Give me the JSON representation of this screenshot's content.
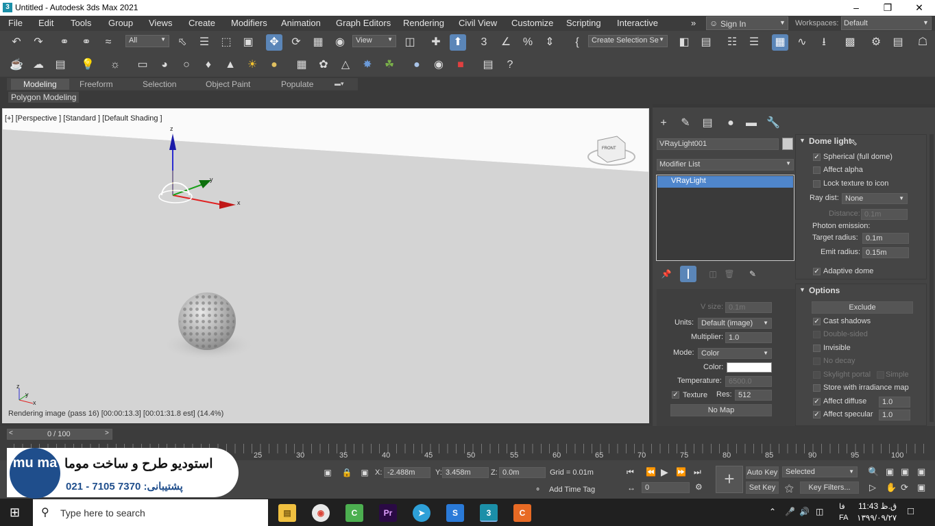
{
  "window": {
    "title": "Untitled - Autodesk 3ds Max 2021",
    "app_icon": "3"
  },
  "menu": [
    "File",
    "Edit",
    "Tools",
    "Group",
    "Views",
    "Create",
    "Modifiers",
    "Animation",
    "Graph Editors",
    "Rendering",
    "Civil View",
    "Customize",
    "Scripting",
    "Interactive"
  ],
  "signin": "Sign In",
  "workspaces": {
    "label": "Workspaces:",
    "value": "Default"
  },
  "toolbar": {
    "selection_filter": "All",
    "ref_coord": "View",
    "named_selection": "Create Selection Se"
  },
  "ribbon": {
    "tabs": [
      "Modeling",
      "Freeform",
      "Selection",
      "Object Paint",
      "Populate"
    ],
    "sub": "Polygon Modeling"
  },
  "viewport": {
    "label": "[+] [Perspective ] [Standard ] [Default Shading ]",
    "status": "Rendering image (pass 16) [00:00:13.3] [00:01:31.8 est]   (14.4%)",
    "axis": {
      "x": "x",
      "y": "y",
      "z": "z"
    },
    "viewcube": "FRONT"
  },
  "modify": {
    "object_name": "VRayLight001",
    "modifier_list": "Modifier List",
    "stack": [
      "VRayLight"
    ],
    "vsize": {
      "label": "V size:",
      "value": "0.1m"
    },
    "units": {
      "label": "Units:",
      "value": "Default (image)"
    },
    "multiplier": {
      "label": "Multiplier:",
      "value": "1.0"
    },
    "mode": {
      "label": "Mode:",
      "value": "Color"
    },
    "color_label": "Color:",
    "temperature": {
      "label": "Temperature:",
      "value": "6500.0"
    },
    "texture": {
      "label": "Texture",
      "res_label": "Res:",
      "res": "512"
    },
    "nomap": "No Map"
  },
  "dome": {
    "title": "Dome light",
    "spherical": "Spherical (full dome)",
    "affect_alpha": "Affect alpha",
    "lock_texture": "Lock texture to icon",
    "ray_dist": {
      "label": "Ray dist:",
      "value": "None"
    },
    "distance": {
      "label": "Distance:",
      "value": "0.1m"
    },
    "photon": "Photon emission:",
    "target_radius": {
      "label": "Target radius:",
      "value": "0.1m"
    },
    "emit_radius": {
      "label": "Emit radius:",
      "value": "0.15m"
    },
    "adaptive": "Adaptive dome"
  },
  "options": {
    "title": "Options",
    "exclude": "Exclude",
    "cast_shadows": "Cast shadows",
    "double_sided": "Double-sided",
    "invisible": "Invisible",
    "no_decay": "No decay",
    "skylight_portal": "Skylight portal",
    "simple": "Simple",
    "store_irr": "Store with irradiance map",
    "affect_diffuse": {
      "label": "Affect diffuse",
      "value": "1.0"
    },
    "affect_specular": {
      "label": "Affect specular",
      "value": "1.0"
    }
  },
  "timeline": {
    "frame": "0 / 100",
    "ticks": [
      "25",
      "30",
      "35",
      "40",
      "45",
      "50",
      "55",
      "60",
      "65",
      "70",
      "75",
      "80",
      "85",
      "90",
      "95",
      "100"
    ]
  },
  "status": {
    "x": {
      "label": "X:",
      "value": "-2.488m"
    },
    "y": {
      "label": "Y:",
      "value": "3.458m"
    },
    "z": {
      "label": "Z:",
      "value": "0.0m"
    },
    "grid": "Grid = 0.01m",
    "add_time_tag": "Add Time Tag",
    "auto_key": "Auto Key",
    "set_key": "Set Key",
    "selected": "Selected",
    "key_filters": "Key Filters...",
    "frame": "0"
  },
  "watermark": {
    "logo": "mu ma",
    "line1": "استودیو طرح و ساخت موما",
    "line2": "پشتیبانی: 7370 7105 - 021"
  },
  "taskbar": {
    "search": "Type here to search",
    "time": "ق.ظ 11:43",
    "date": "۱۳۹۹/۰۹/۲۷",
    "lang": "FA",
    "lang2": "فا"
  }
}
